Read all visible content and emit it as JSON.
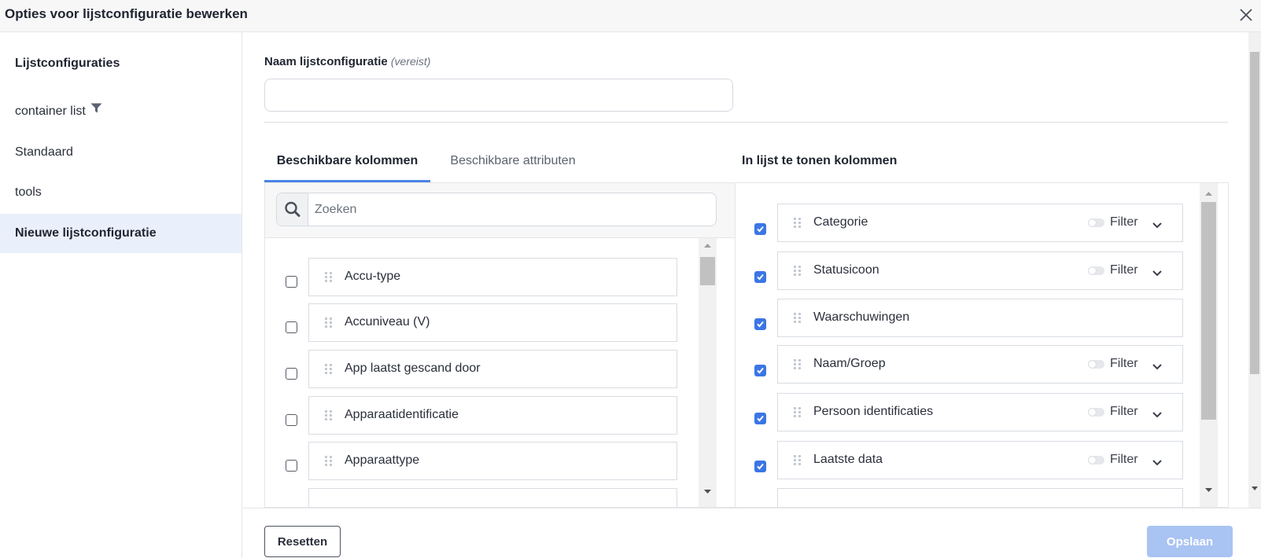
{
  "dialog": {
    "title": "Opties voor lijstconfiguratie bewerken"
  },
  "sidebar": {
    "heading": "Lijstconfiguraties",
    "items": [
      {
        "label": "container list",
        "has_filter_icon": true
      },
      {
        "label": "Standaard"
      },
      {
        "label": "tools"
      },
      {
        "label": "Nieuwe lijstconfiguratie",
        "active": true
      }
    ]
  },
  "form": {
    "name_label": "Naam lijstconfiguratie",
    "name_required": "(vereist)",
    "name_value": ""
  },
  "tabs": [
    {
      "label": "Beschikbare kolommen",
      "active": true
    },
    {
      "label": "Beschikbare attributen",
      "active": false
    }
  ],
  "search": {
    "placeholder": "Zoeken"
  },
  "available_columns": [
    {
      "label": "Accu-type",
      "checked": false
    },
    {
      "label": "Accuniveau (V)",
      "checked": false
    },
    {
      "label": "App laatst gescand door",
      "checked": false
    },
    {
      "label": "Apparaatidentificatie",
      "checked": false
    },
    {
      "label": "Apparaattype",
      "checked": false
    }
  ],
  "shown_columns": {
    "heading": "In lijst te tonen kolommen",
    "filter_label": "Filter",
    "items": [
      {
        "label": "Categorie",
        "checked": true,
        "has_filter": true,
        "filter_on": false
      },
      {
        "label": "Statusicoon",
        "checked": true,
        "has_filter": true,
        "filter_on": false
      },
      {
        "label": "Waarschuwingen",
        "checked": true,
        "has_filter": false
      },
      {
        "label": "Naam/Groep",
        "checked": true,
        "has_filter": true,
        "filter_on": false
      },
      {
        "label": "Persoon identificaties",
        "checked": true,
        "has_filter": true,
        "filter_on": false
      },
      {
        "label": "Laatste data",
        "checked": true,
        "has_filter": true,
        "filter_on": false
      }
    ]
  },
  "footer": {
    "reset_label": "Resetten",
    "save_label": "Opslaan"
  },
  "colors": {
    "accent": "#4a84e6",
    "checkbox": "#3b76e5",
    "save_disabled": "#a9c3f2",
    "active_item": "#eaf0fb"
  }
}
